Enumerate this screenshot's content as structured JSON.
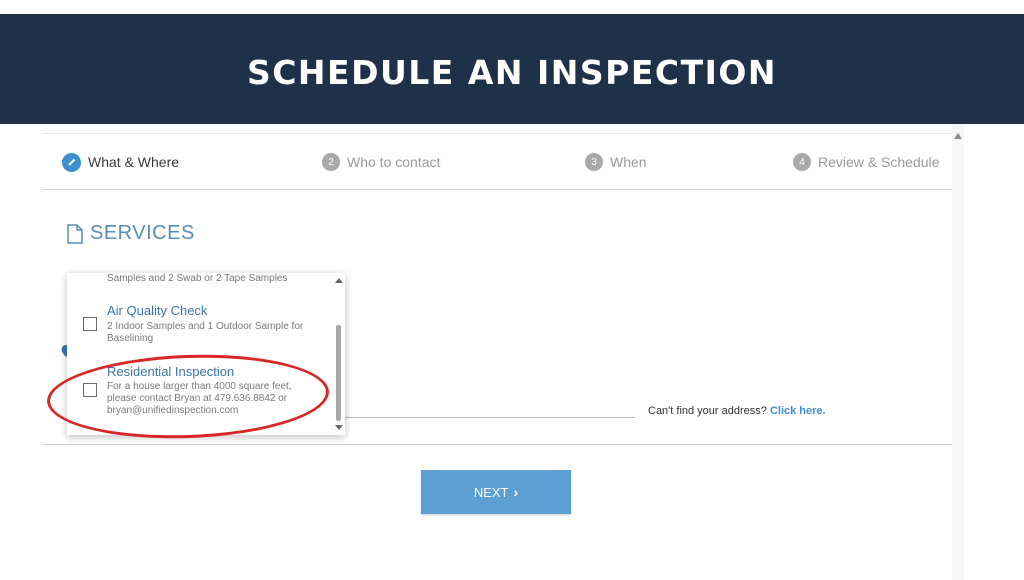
{
  "header": {
    "title": "SCHEDULE AN INSPECTION"
  },
  "steps": [
    {
      "number": "",
      "label": "What & Where",
      "active": true
    },
    {
      "number": "2",
      "label": "Who to contact",
      "active": false
    },
    {
      "number": "3",
      "label": "When",
      "active": false
    },
    {
      "number": "4",
      "label": "Review & Schedule",
      "active": false
    }
  ],
  "services": {
    "heading": "SERVICES"
  },
  "dropdown": {
    "cut_text": "Samples and 2 Swab or 2 Tape Samples",
    "items": [
      {
        "title": "Air Quality Check",
        "description": "2 Indoor Samples and 1 Outdoor Sample for Baselining",
        "checked": false
      },
      {
        "title": "Residential Inspection",
        "description": "For a house larger than 4000 square feet, please contact Bryan at 479.636.8842 or bryan@unifiedinspection.com",
        "checked": false
      }
    ]
  },
  "address": {
    "cant_find_text": "Can't find your address?",
    "click_here": "Click here."
  },
  "next_button": {
    "label": "NEXT"
  },
  "colors": {
    "header_bg": "#1f3049",
    "accent": "#3f8fd0",
    "button_bg": "#5e9fd3",
    "highlight_ring": "#d92626"
  },
  "icons": [
    "pencil-icon",
    "document-icon",
    "location-pin-icon",
    "chevron-right-icon",
    "checkbox-icon"
  ]
}
